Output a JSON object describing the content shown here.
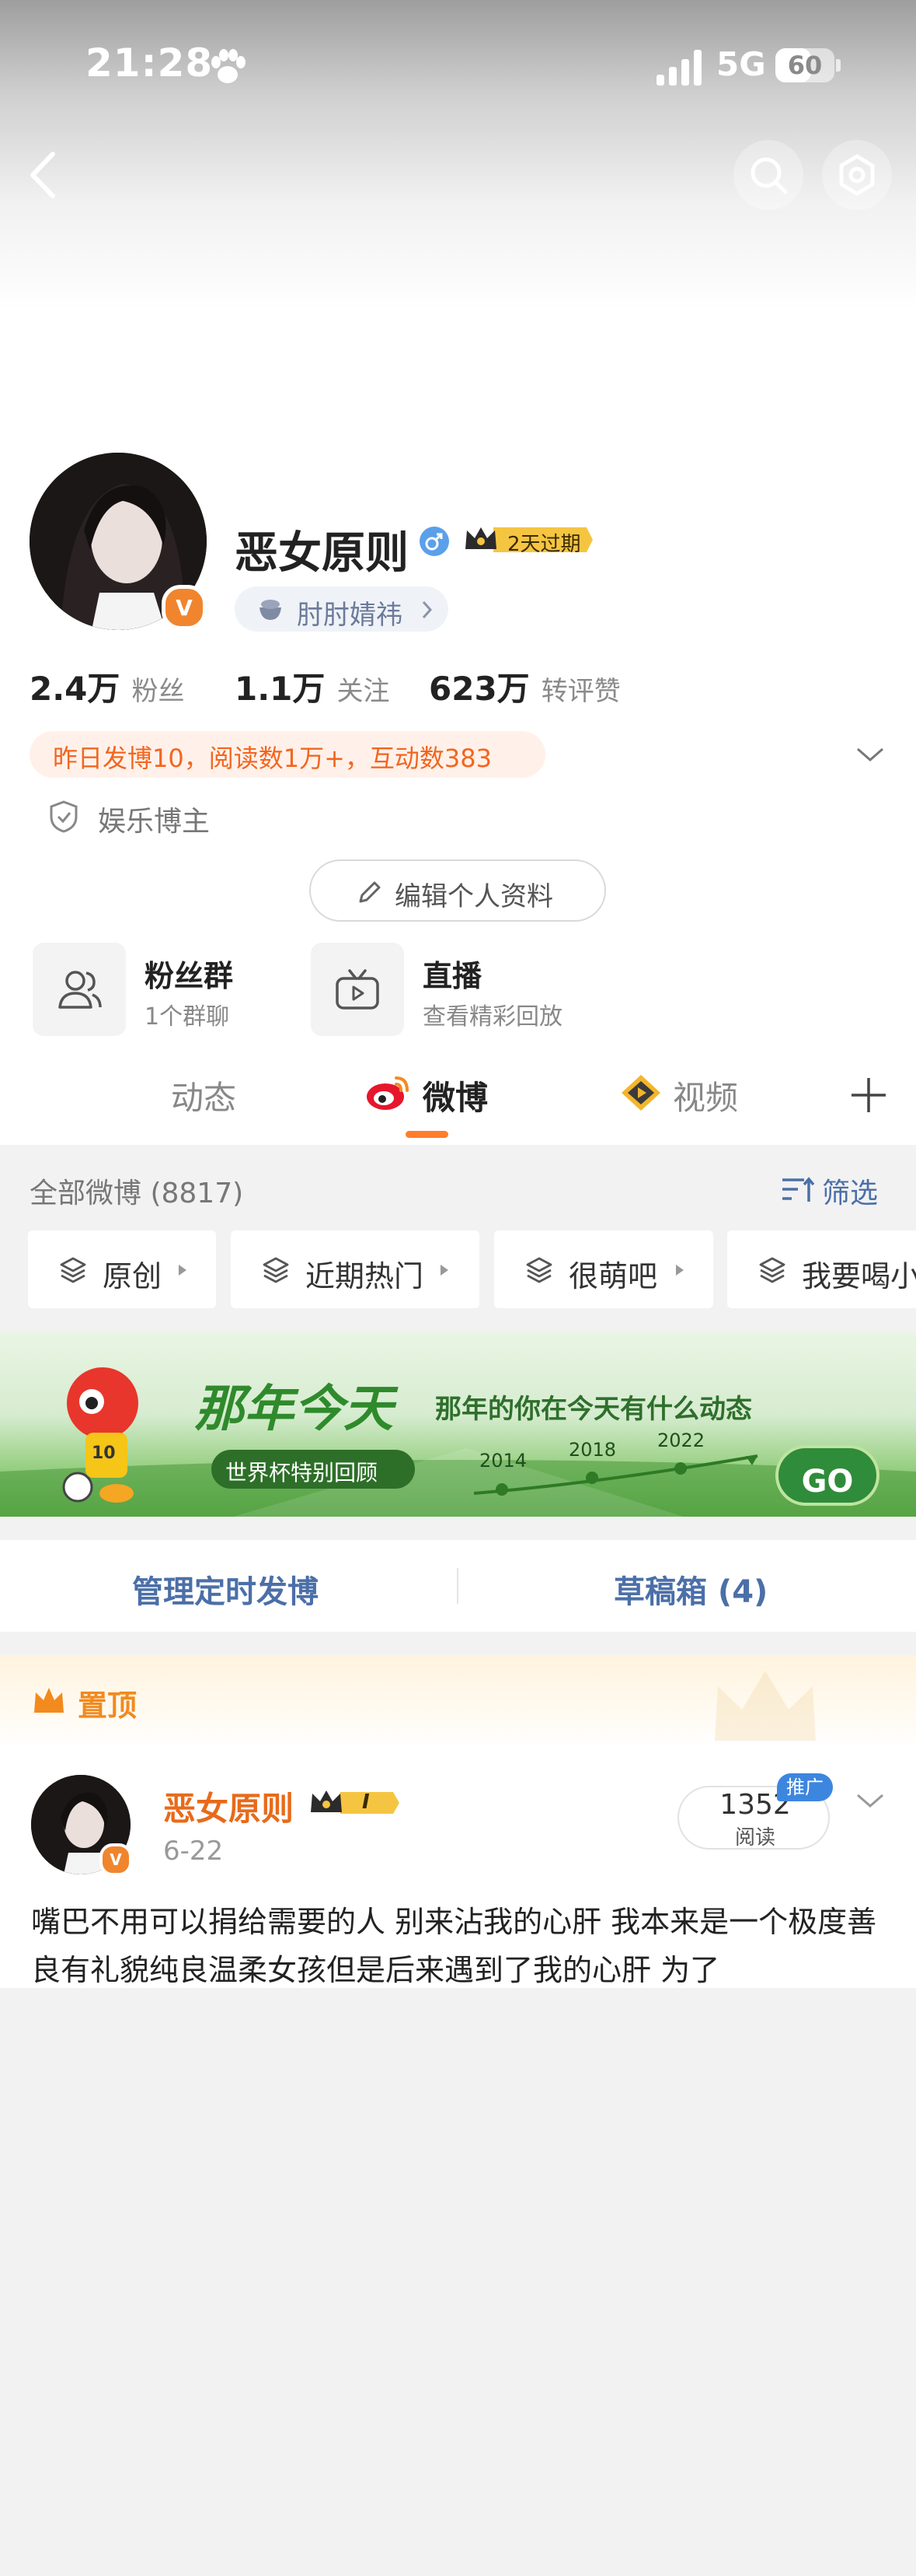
{
  "status_bar": {
    "time": "21:28",
    "network": "5G",
    "battery": "60",
    "battery_level": 0.6
  },
  "header": {
    "back_icon": "chevron-left-icon",
    "search_icon": "search-icon",
    "settings_icon": "gear-icon"
  },
  "profile": {
    "name": "恶女原则",
    "vip_tag": "2天过期",
    "group_pill": "肘肘婧祎",
    "verified_badge": "V",
    "stats": [
      {
        "value": "2.4万",
        "label": "粉丝"
      },
      {
        "value": "1.1万",
        "label": "关注"
      },
      {
        "value": "623万",
        "label": "转评赞"
      }
    ],
    "activity_summary": "昨日发博10，阅读数1万+，互动数383",
    "role_label": "娱乐博主",
    "edit_button": "编辑个人资料"
  },
  "features": [
    {
      "title": "粉丝群",
      "subtitle": "1个群聊",
      "icon": "people-icon"
    },
    {
      "title": "直播",
      "subtitle": "查看精彩回放",
      "icon": "tv-icon"
    }
  ],
  "tabs": {
    "items": [
      "动态",
      "微博",
      "视频"
    ],
    "active": "微博",
    "add_icon": "plus-icon"
  },
  "feed": {
    "all_count_label": "全部微博 (8817)",
    "filter_label": "筛选",
    "chips": [
      "原创",
      "近期热门",
      "很萌吧",
      "我要喝小"
    ]
  },
  "banner": {
    "title": "那年今天",
    "subtitle": "那年的你在今天有什么动态",
    "pill": "世界杯特别回顾",
    "years": [
      "2014",
      "2018",
      "2022"
    ],
    "go_button": "GO",
    "mascot_number": "10"
  },
  "manage": {
    "scheduled": "管理定时发博",
    "drafts": "草稿箱 (4)"
  },
  "pinned_post": {
    "pin_label": "置顶",
    "author": "恶女原则",
    "badge": "I",
    "date": "6-22",
    "reads": "1352",
    "reads_label": "阅读",
    "promo": "推广",
    "text": "嘴巴不用可以捐给需要的人 别来沾我的心肝 我本来是一个极度善良有礼貌纯良温柔女孩但是后来遇到了我的心肝 为了"
  },
  "colors": {
    "accent_orange": "#ff7d2a",
    "link_blue": "#4b6fa8",
    "vip_gold": "#f5c542"
  }
}
